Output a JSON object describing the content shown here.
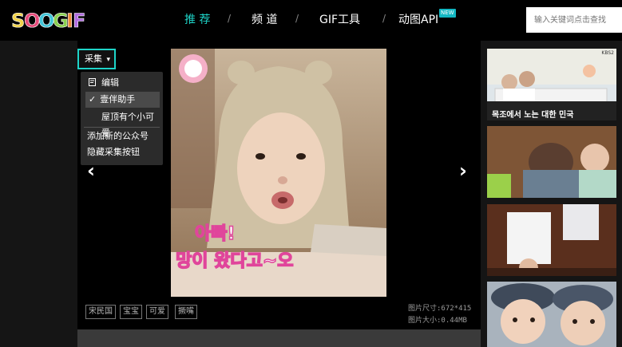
{
  "logo": {
    "text": "SOOGIF"
  },
  "nav": {
    "recommend": "推 荐",
    "channel": "频 道",
    "gif_tool": "GIF工具",
    "api": "动图API",
    "new_badge": "NEW",
    "separator": "/"
  },
  "search": {
    "placeholder": "输入关键词点击查找"
  },
  "collect": {
    "label": "采集",
    "caret": "▾"
  },
  "menu": {
    "edit": "编辑",
    "assistant": "壹伴助手",
    "account": "屋顶有个小可爱",
    "add_account": "添加新的公众号",
    "hide": "隐藏采集按钮",
    "check": "✓"
  },
  "gif": {
    "caption_line1": "아빠!",
    "caption_line2": "망이 왔다고~오"
  },
  "tags": [
    "宋民国",
    "宝宝",
    "可爱",
    "撅嘴"
  ],
  "meta": {
    "size_label": "图片尺寸:672*415",
    "file_label": "图片大小:0.44MB"
  },
  "thumbs": {
    "thumb1_caption": "목조에서 노는 대한 민국",
    "thumb1_corner": "KBS2"
  },
  "arrows": {
    "prev": "‹",
    "next": "›"
  },
  "colors": {
    "accent": "#1ed4c8",
    "bg": "#151515"
  }
}
